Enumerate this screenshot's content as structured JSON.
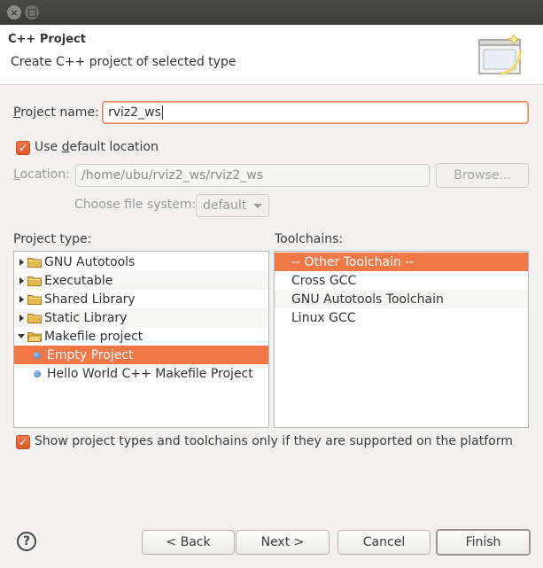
{
  "window": {
    "close_glyph": "×"
  },
  "header": {
    "title": "C++ Project",
    "description": "Create C++ project of selected type",
    "icon": "wizard-banner-icon"
  },
  "project_name": {
    "label_underlined": "P",
    "label_rest": "roject name:",
    "value": "rviz2_ws"
  },
  "use_default_location": {
    "checked": true,
    "label_before": "Use ",
    "label_underlined": "d",
    "label_after": "efault location"
  },
  "location": {
    "label_underlined": "L",
    "label_rest": "ocation:",
    "value": "/home/ubu/rviz2_ws/rviz2_ws",
    "browse_label": "Browse...",
    "browse_underlined": "w"
  },
  "file_system": {
    "label": "Choose file system:",
    "selected": "default"
  },
  "project_type": {
    "label": "Project type:",
    "items": [
      {
        "label": "GNU Autotools",
        "kind": "folder",
        "expanded": false,
        "depth": 0
      },
      {
        "label": "Executable",
        "kind": "folder",
        "expanded": false,
        "depth": 0
      },
      {
        "label": "Shared Library",
        "kind": "folder",
        "expanded": false,
        "depth": 0
      },
      {
        "label": "Static Library",
        "kind": "folder",
        "expanded": false,
        "depth": 0
      },
      {
        "label": "Makefile project",
        "kind": "folder",
        "expanded": true,
        "depth": 0
      },
      {
        "label": "Empty Project",
        "kind": "leaf",
        "depth": 1,
        "selected": true
      },
      {
        "label": "Hello World C++ Makefile Project",
        "kind": "leaf",
        "depth": 1
      }
    ]
  },
  "toolchains": {
    "label": "Toolchains:",
    "items": [
      {
        "label": "-- Other Toolchain --",
        "selected": true
      },
      {
        "label": "Cross GCC"
      },
      {
        "label": "GNU Autotools Toolchain"
      },
      {
        "label": "Linux GCC"
      }
    ]
  },
  "show_supported": {
    "checked": true,
    "label": "Show project types and toolchains only if they are supported on the platform"
  },
  "buttons": {
    "help": "?",
    "back": "< Back",
    "next": "Next >",
    "cancel": "Cancel",
    "finish": "Finish"
  },
  "colors": {
    "accent": "#f07746",
    "folder": "#e6b94f"
  }
}
